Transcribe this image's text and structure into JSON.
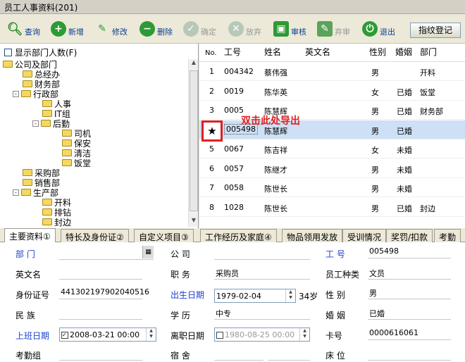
{
  "title": "员工人事资料(201)",
  "toolbar": {
    "query": "查询",
    "add": "新增",
    "edit": "修改",
    "delete": "删除",
    "confirm": "确定",
    "abandon": "放弃",
    "audit": "审核",
    "unaudit": "弃审",
    "exit": "退出",
    "fingerprint": "指纹登记"
  },
  "left": {
    "show_count_label": "显示部门人数(F)",
    "tree": [
      "公司及部门",
      "总经办",
      "财务部",
      "行政部",
      "人事",
      "IT组",
      "后勤",
      "司机",
      "保安",
      "清洁",
      "饭堂",
      "采购部",
      "销售部",
      "生产部",
      "开料",
      "排钻",
      "封边"
    ]
  },
  "grid": {
    "headers": [
      "No.",
      "工号",
      "姓名",
      "英文名",
      "性别",
      "婚姻",
      "部门"
    ],
    "rows": [
      {
        "no": "1",
        "id": "004342",
        "name": "蔡伟强",
        "en": "",
        "sex": "男",
        "mar": "",
        "dept": "开料"
      },
      {
        "no": "2",
        "id": "0019",
        "name": "陈华英",
        "en": "",
        "sex": "女",
        "mar": "已婚",
        "dept": "饭堂"
      },
      {
        "no": "3",
        "id": "0005",
        "name": "陈慧辉",
        "en": "",
        "sex": "男",
        "mar": "已婚",
        "dept": "财务部"
      },
      {
        "no": "★",
        "id": "005498",
        "name": "陈慧辉",
        "en": "",
        "sex": "男",
        "mar": "已婚",
        "dept": ""
      },
      {
        "no": "5",
        "id": "0067",
        "name": "陈吉祥",
        "en": "",
        "sex": "女",
        "mar": "未婚",
        "dept": ""
      },
      {
        "no": "6",
        "id": "0057",
        "name": "陈继才",
        "en": "",
        "sex": "男",
        "mar": "未婚",
        "dept": ""
      },
      {
        "no": "7",
        "id": "0058",
        "name": "陈世长",
        "en": "",
        "sex": "男",
        "mar": "未婚",
        "dept": ""
      },
      {
        "no": "8",
        "id": "1028",
        "name": "陈世长",
        "en": "",
        "sex": "男",
        "mar": "已婚",
        "dept": "封边"
      }
    ],
    "annotation": "双击此处导出",
    "star": "★"
  },
  "tabs": [
    "主要资料①",
    "特长及身份证②",
    "自定义项目③",
    "工作经历及家庭④",
    "物品领用发放",
    "受训情况",
    "奖罚/扣款",
    "考勤"
  ],
  "form": {
    "dept_label": "部    门",
    "company_label": "公    司",
    "empno_label": "工  号",
    "empno": "005498",
    "en_label": "英文名",
    "position_label": "职    务",
    "position": "采购员",
    "type_label": "员工种类",
    "type": "文员",
    "idcard_label": "身份证号",
    "idcard": "441302197902040516",
    "birth_label": "出生日期",
    "birth": "1979-02-04",
    "age": "34岁",
    "sex_label": "性  别",
    "sex": "男",
    "nation_label": "民    族",
    "edu_label": "学    历",
    "edu": "中专",
    "marriage_label": "婚  姻",
    "marriage": "已婚",
    "hire_label": "上班日期",
    "hire": "2008-03-21 00:00",
    "leave_label": "离职日期",
    "leave": "1980-08-25 00:00",
    "card_label": "卡号",
    "card": "0000616061",
    "att_label": "考勤组",
    "dorm_label": "宿    舍",
    "bed_label": "床    位"
  }
}
